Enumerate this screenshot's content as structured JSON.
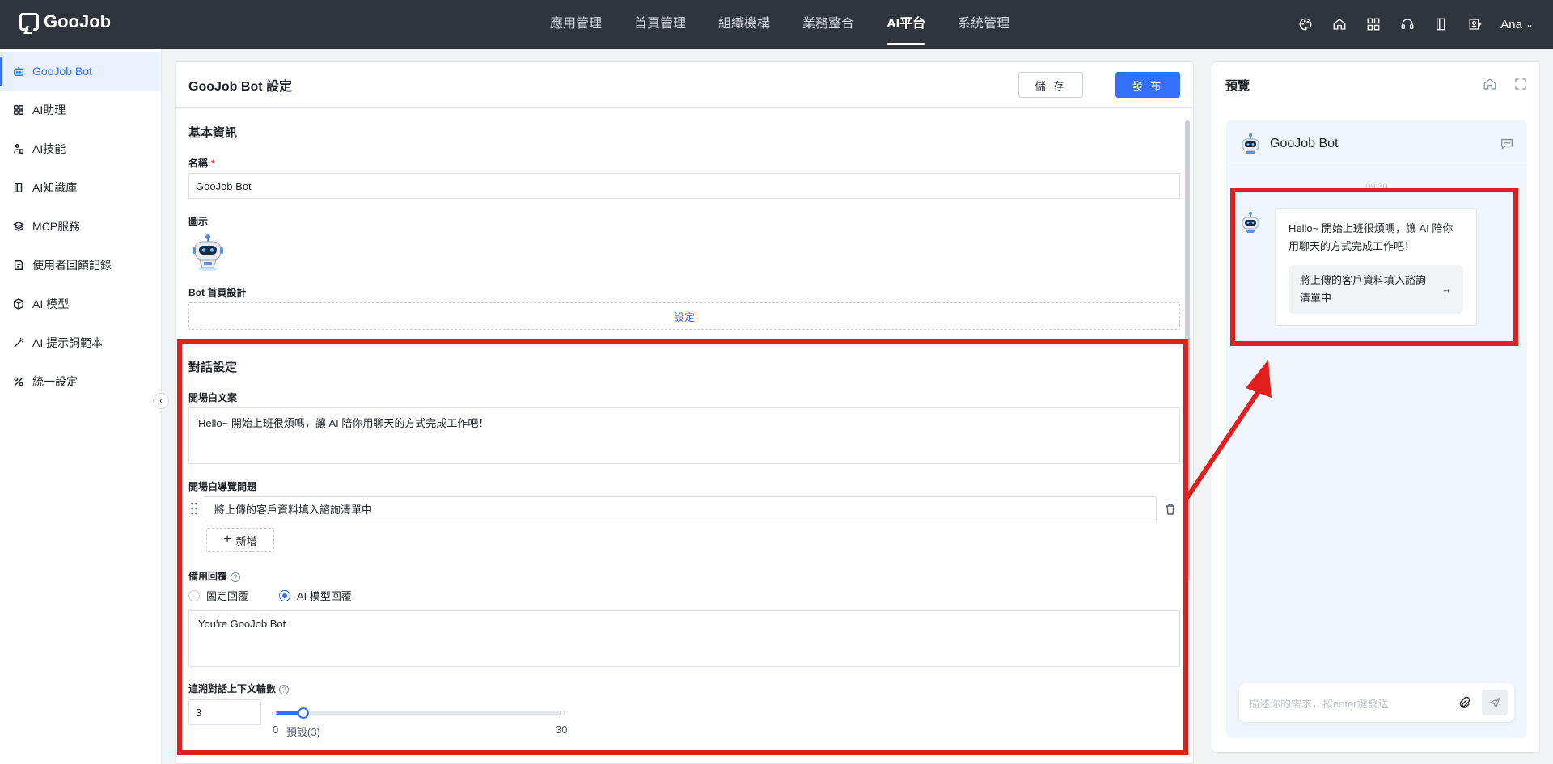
{
  "brand": {
    "name": "GooJob"
  },
  "nav": {
    "items": [
      {
        "label": "應用管理"
      },
      {
        "label": "首頁管理"
      },
      {
        "label": "組織機構"
      },
      {
        "label": "業務整合"
      },
      {
        "label": "AI平台",
        "active": true
      },
      {
        "label": "系統管理"
      }
    ]
  },
  "top_icons": [
    "palette-icon",
    "home-icon",
    "grid-icon",
    "headset-icon",
    "book-icon",
    "user-card-icon"
  ],
  "user": {
    "name": "Ana"
  },
  "sidebar": {
    "items": [
      {
        "label": "GooJob Bot",
        "icon": "robot-icon",
        "active": true
      },
      {
        "label": "AI助理",
        "icon": "apps-icon"
      },
      {
        "label": "AI技能",
        "icon": "skill-icon"
      },
      {
        "label": "AI知識庫",
        "icon": "book-icon"
      },
      {
        "label": "MCP服務",
        "icon": "layers-icon"
      },
      {
        "label": "使用者回饋記錄",
        "icon": "feedback-icon"
      },
      {
        "label": "AI 模型",
        "icon": "cube-icon"
      },
      {
        "label": "AI 提示詞範本",
        "icon": "wand-icon"
      },
      {
        "label": "統一設定",
        "icon": "percent-icon"
      }
    ]
  },
  "panel": {
    "title": "GooJob Bot 設定",
    "save_label": "儲 存",
    "publish_label": "發 布"
  },
  "basic": {
    "section_title": "基本資訊",
    "name_label": "名稱",
    "name_value": "GooJob Bot",
    "icon_label": "圖示",
    "home_design_label": "Bot 首頁設計",
    "setup_link": "設定"
  },
  "dialog": {
    "section_title": "對話設定",
    "opening_label": "開場白文案",
    "opening_value": "Hello~ 開始上班很煩嗎，讓 AI 陪你用聊天的方式完成工作吧！",
    "guide_label": "開場白導覽問題",
    "guide_value": "將上傳的客戶資料填入諮詢清單中",
    "add_label": "新增",
    "fallback_label": "備用回覆",
    "radio_fixed": "固定回覆",
    "radio_ai": "AI 模型回覆",
    "fallback_selected": "AI 模型回覆",
    "fallback_value": "You're GooJob Bot",
    "context_label": "追溯對話上下文輪數",
    "context_value": "3",
    "slider_min": "0",
    "slider_default": "預設(3)",
    "slider_max": "30",
    "slider_level": 3,
    "slider_range": [
      0,
      30
    ]
  },
  "preview": {
    "title": "預覽",
    "bot_name": "GooJob Bot",
    "time": "09:30",
    "greeting": "Hello~ 開始上班很煩嗎，讓 AI 陪你用聊天的方式完成工作吧！",
    "suggestion": "將上傳的客戶資料填入諮詢清單中",
    "input_placeholder": "描述你的需求，按enter鍵發送"
  },
  "colors": {
    "topbar": "#2f343d",
    "accent": "#3370ff",
    "highlight_red": "#e01f1f"
  }
}
